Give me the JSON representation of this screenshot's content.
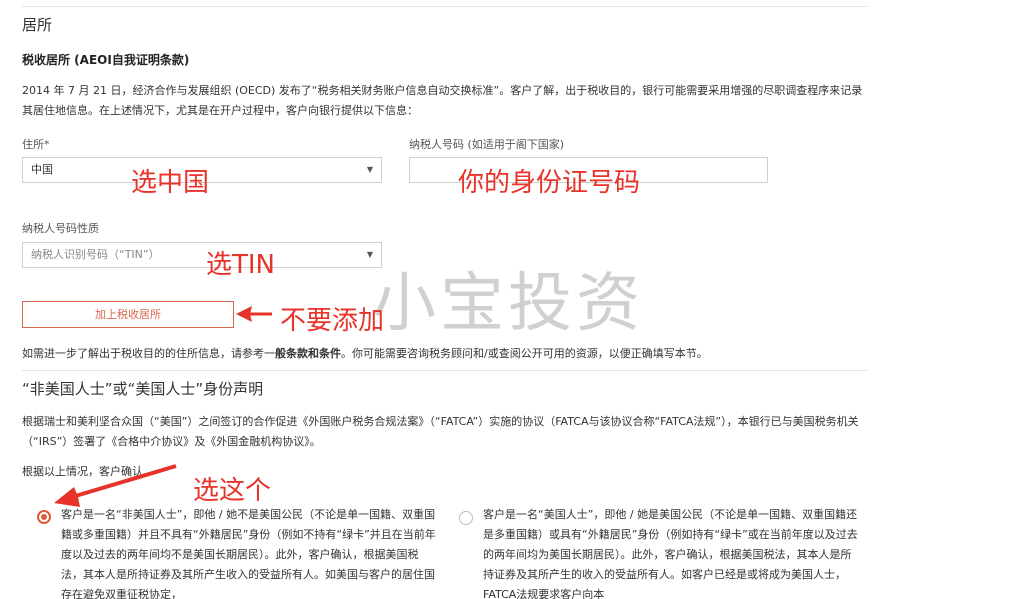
{
  "residence": {
    "section_title": "居所",
    "subtitle": "税收居所 (AEOI自我证明条款)",
    "intro": "2014 年 7 月 21 日，经济合作与发展组织 (OECD) 发布了“税务相关财务账户信息自动交换标准”。客户了解，出于税收目的，银行可能需要采用增强的尽职调查程序来记录其居住地信息。在上述情况下，尤其是在开户过程中，客户向银行提供以下信息：",
    "country_label": "住所",
    "required_mark": "*",
    "country_value": "中国",
    "tin_label": "纳税人号码 (如适用于阁下国家)",
    "tin_value": "",
    "tin_type_label": "纳税人号码性质",
    "tin_type_placeholder": "纳税人识别号码（“TIN”）",
    "add_button": "加上税收居所",
    "note_prefix": "如需进一步了解出于税收目的的住所信息，请参考一",
    "note_link": "般条款和条件",
    "note_suffix": "。你可能需要咨询税务顾问和/或查阅公开可用的资源，以便正确填写本节。"
  },
  "fatca": {
    "section_title": "“非美国人士”或“美国人士”身份声明",
    "intro": "根据瑞士和美利坚合众国（“美国”）之间签订的合作促进《外国账户税务合规法案》（“FATCA”）实施的协议（FATCA与该协议合称“FATCA法规”），本银行已与美国税务机关（“IRS”）签署了《合格中介协议》及《外国金融机构协议》。",
    "confirm_label": "根据以上情况，客户确认",
    "option_non_us": "客户是一名“非美国人士”，即他 / 她不是美国公民（不论是单一国籍、双重国籍或多重国籍）并且不具有“外籍居民”身份（例如不持有“绿卡”并且在当前年度以及过去的两年间均不是美国长期居民）。此外，客户确认，根据美国税法，其本人是所持证券及其所产生收入的受益所有人。如美国与客户的居住国存在避免双重征税协定，",
    "option_us": "客户是一名“美国人士”，即他 / 她是美国公民（不论是单一国籍、双重国籍还是多重国籍）或具有“外籍居民”身份（例如持有“绿卡”或在当前年度以及过去的两年间均为美国长期居民）。此外，客户确认，根据美国税法，其本人是所持证券及其所产生的收入的受益所有人。如客户已经是或将成为美国人士，FATCA法规要求客户向本"
  },
  "annotations": {
    "choose_china": "选中国",
    "your_id": "你的身份证号码",
    "choose_tin": "选TIN",
    "dont_add": "不要添加",
    "choose_this": "选这个",
    "watermark": "小宝投资"
  },
  "colors": {
    "annotation_red": "#e8332a",
    "accent_orange": "#e05a3a",
    "button_border": "#d9664f"
  }
}
